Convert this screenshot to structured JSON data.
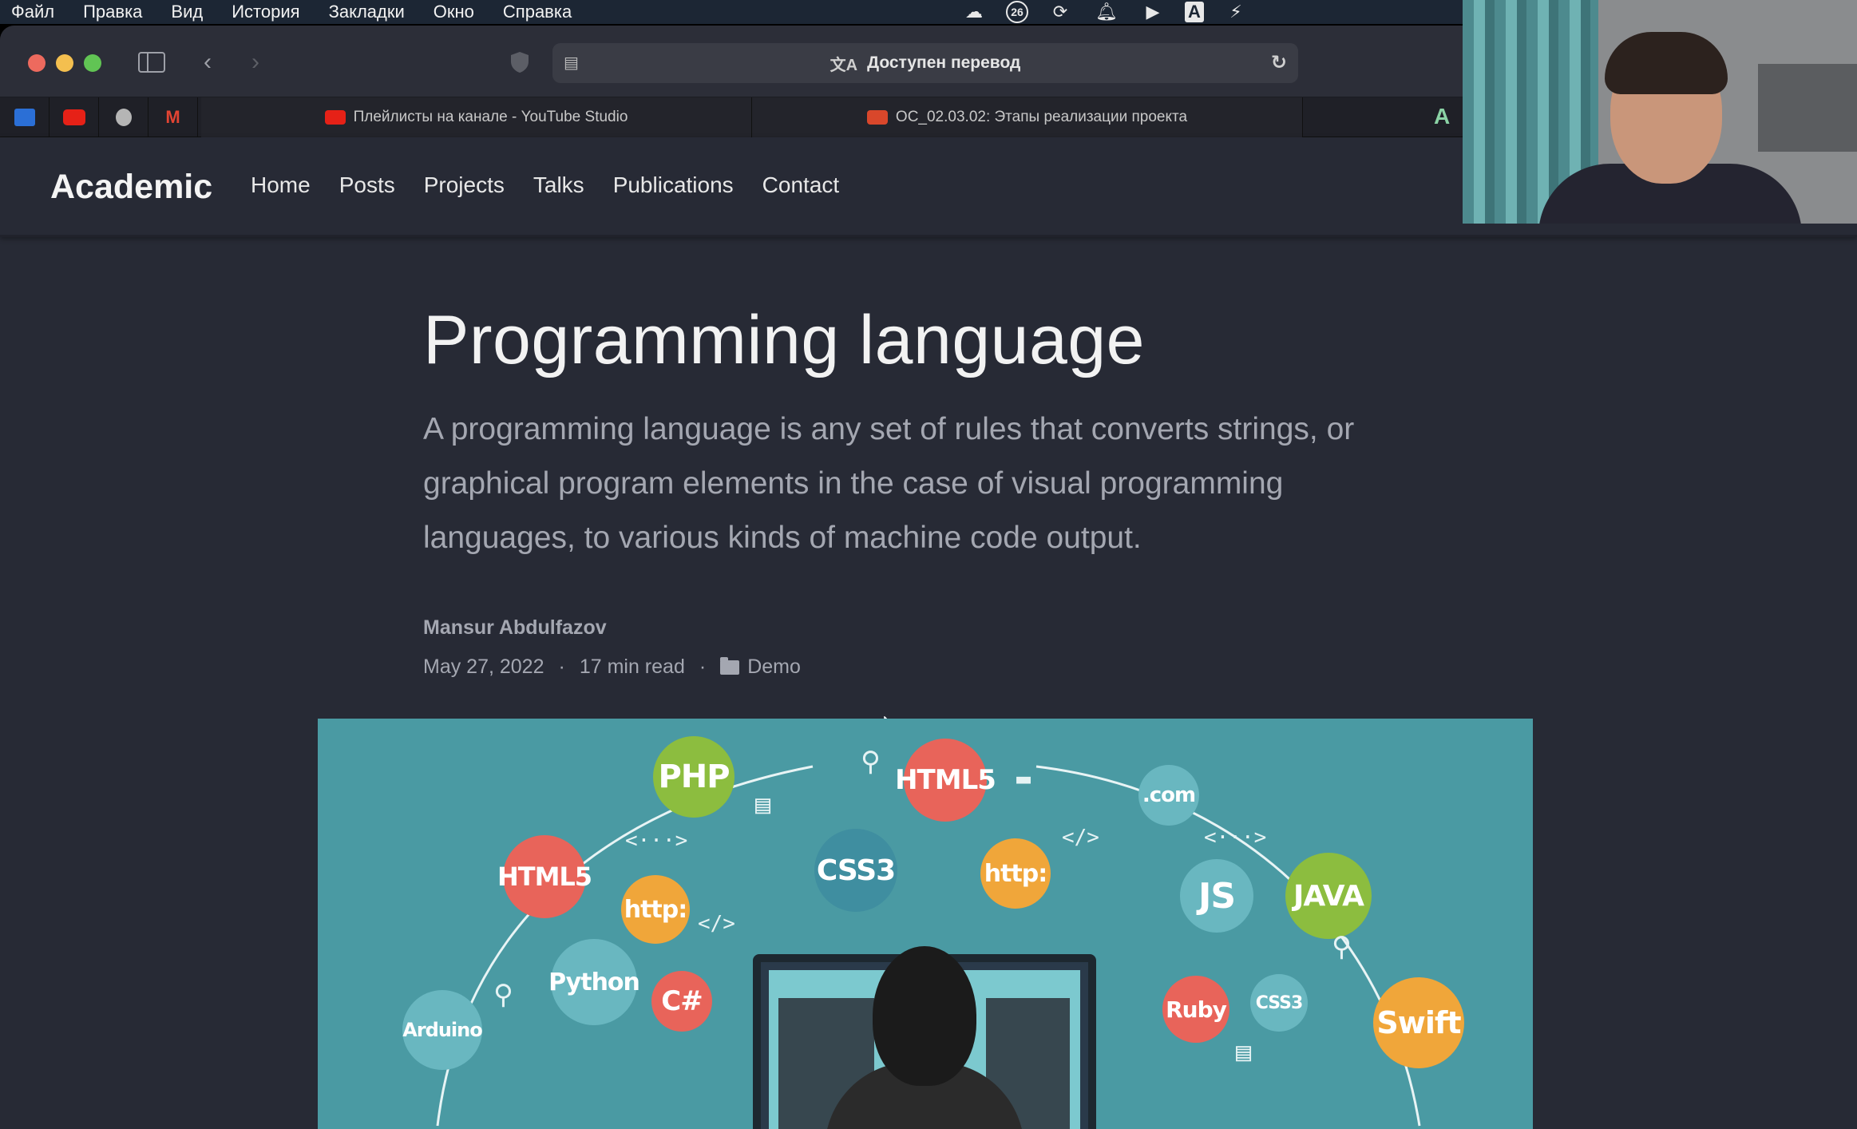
{
  "menubar": {
    "items": [
      "Файл",
      "Правка",
      "Вид",
      "История",
      "Закладки",
      "Окно",
      "Справка"
    ]
  },
  "status_icons": [
    "creative-cloud-icon",
    "calendar-icon",
    "sync-icon",
    "notification-icon",
    "play-icon",
    "input-source-icon",
    "battery-icon"
  ],
  "status_badge": "26",
  "input_source": "A",
  "browser": {
    "address_text": "Доступен перевод",
    "tabs": [
      {
        "label": "Плейлисты на канале - YouTube Studio",
        "favicon_color": "#e62117"
      },
      {
        "label": "OC_02.03.02: Этапы реализации проекта",
        "favicon_color": "#d9472b"
      }
    ],
    "right_tab_icon": "A"
  },
  "site": {
    "brand": "Academic",
    "nav": [
      "Home",
      "Posts",
      "Projects",
      "Talks",
      "Publications",
      "Contact"
    ]
  },
  "article": {
    "title": "Programming language",
    "summary": "A programming language is any set of rules that converts strings, or graphical program elements in the case of visual programming languages, to various kinds of machine code output.",
    "author": "Mansur Abdulfazov",
    "date": "May 27, 2022",
    "read_time": "17 min read",
    "category": "Demo",
    "separator": "·"
  },
  "hero": {
    "bubbles": [
      "PHP",
      "HTML5",
      ".com",
      "HTML5",
      "http:",
      "CSS3",
      "http:",
      "JS",
      "JAVA",
      "Python",
      "C#",
      "Ruby",
      "CSS3",
      "Arduino",
      "Swift"
    ],
    "deco": [
      "<···>",
      "</>",
      "</>",
      "<···>"
    ]
  },
  "colors": {
    "page_bg": "#272a35",
    "hero_bg": "#4a9aa3",
    "text_primary": "#f2f2f2",
    "text_muted": "#a4a7b1"
  }
}
